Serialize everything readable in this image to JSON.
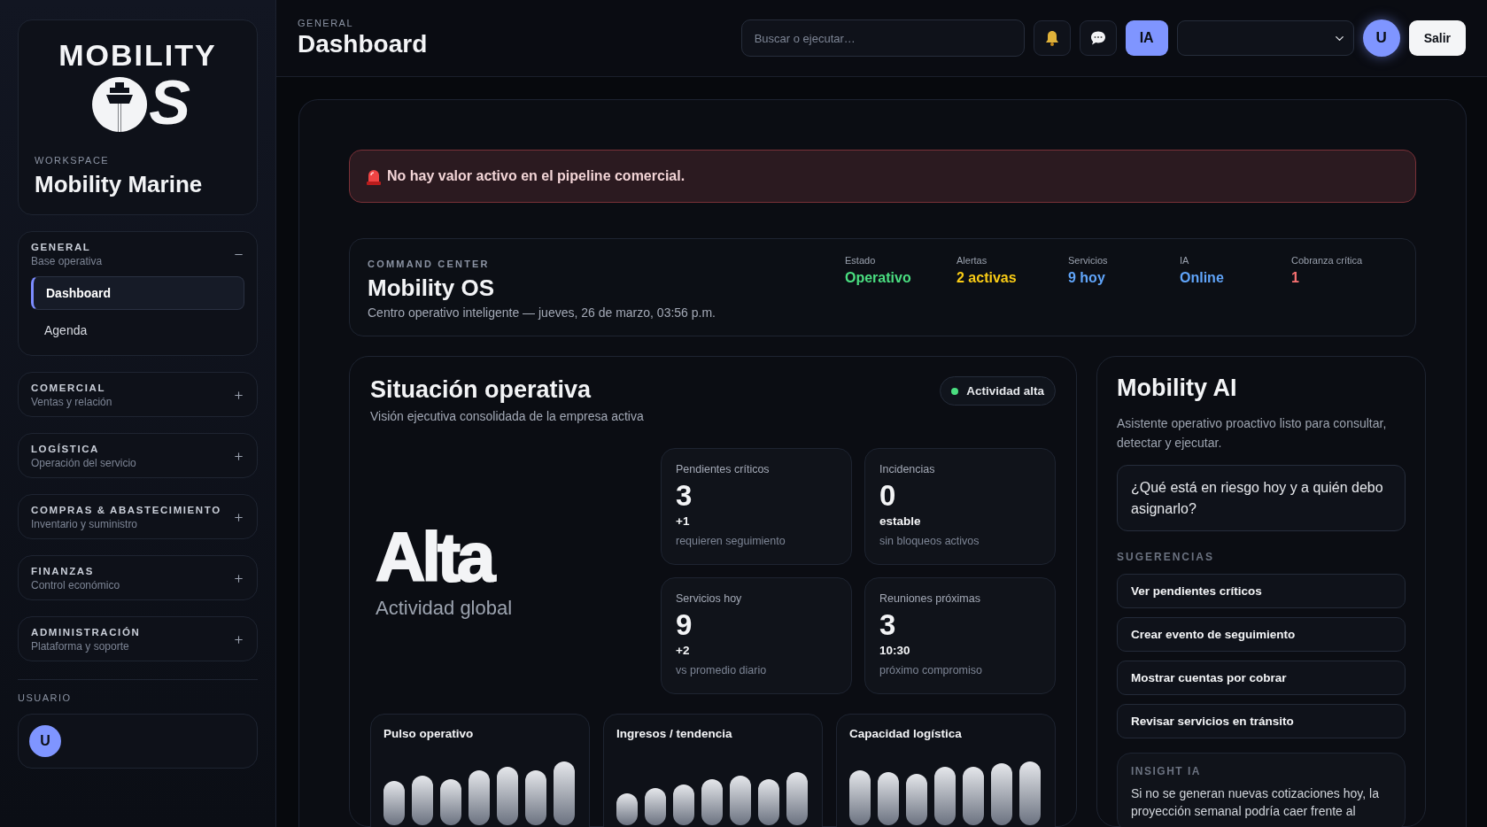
{
  "sidebar": {
    "logo": {
      "wordmark": "MOBILITY",
      "mark_letter": "S"
    },
    "workspace_label": "WORKSPACE",
    "workspace_name": "Mobility Marine",
    "groups": [
      {
        "title": "GENERAL",
        "subtitle": "Base operativa",
        "expanded": true,
        "items": [
          {
            "label": "Dashboard",
            "selected": true
          },
          {
            "label": "Agenda",
            "selected": false
          }
        ]
      },
      {
        "title": "COMERCIAL",
        "subtitle": "Ventas y relación",
        "expanded": false
      },
      {
        "title": "LOGÍSTICA",
        "subtitle": "Operación del servicio",
        "expanded": false
      },
      {
        "title": "COMPRAS & ABASTECIMIENTO",
        "subtitle": "Inventario y suministro",
        "expanded": false
      },
      {
        "title": "FINANZAS",
        "subtitle": "Control económico",
        "expanded": false
      },
      {
        "title": "ADMINISTRACIÓN",
        "subtitle": "Plataforma y soporte",
        "expanded": false
      }
    ],
    "user_label": "USUARIO",
    "user_initial": "U"
  },
  "header": {
    "section": "GENERAL",
    "title": "Dashboard",
    "search": {
      "placeholder": "Buscar o ejecutar…"
    },
    "ai_button": "IA",
    "avatar_initial": "U",
    "logout": "Salir"
  },
  "alert": {
    "text": "No hay valor activo en el pipeline comercial."
  },
  "command_center": {
    "eyebrow": "COMMAND CENTER",
    "title": "Mobility OS",
    "subtitle": "Centro operativo inteligente — jueves, 26 de marzo, 03:56 p.m.",
    "stats": [
      {
        "label": "Estado",
        "value": "Operativo",
        "color": "#4ade80"
      },
      {
        "label": "Alertas",
        "value": "2 activas",
        "color": "#facc15"
      },
      {
        "label": "Servicios",
        "value": "9 hoy",
        "color": "#60a5fa"
      },
      {
        "label": "IA",
        "value": "Online",
        "color": "#60a5fa"
      },
      {
        "label": "Cobranza crítica",
        "value": "1",
        "color": "#f87171"
      }
    ]
  },
  "situation": {
    "title": "Situación operativa",
    "subtitle": "Visión ejecutiva consolidada de la empresa activa",
    "status": {
      "label": "Actividad alta",
      "color": "#4ade80"
    },
    "hero": {
      "value": "Alta",
      "caption": "Actividad global"
    },
    "kpis": [
      {
        "label": "Pendientes críticos",
        "value": "3",
        "delta": "+1",
        "note": "requieren seguimiento"
      },
      {
        "label": "Incidencias",
        "value": "0",
        "delta": "estable",
        "note": "sin bloqueos activos"
      },
      {
        "label": "Servicios hoy",
        "value": "9",
        "delta": "+2",
        "note": "vs promedio diario"
      },
      {
        "label": "Reuniones próximas",
        "value": "3",
        "delta": "10:30",
        "note": "próximo compromiso"
      }
    ],
    "mini_charts": [
      {
        "title": "Pulso operativo"
      },
      {
        "title": "Ingresos / tendencia"
      },
      {
        "title": "Capacidad logística"
      }
    ]
  },
  "assistant": {
    "title": "Mobility AI",
    "description": "Asistente operativo proactivo listo para consultar, detectar y ejecutar.",
    "prompt": "¿Qué está en riesgo hoy y a quién debo asignarlo?",
    "suggestions_label": "SUGERENCIAS",
    "suggestions": [
      "Ver pendientes críticos",
      "Crear evento de seguimiento",
      "Mostrar cuentas por cobrar",
      "Revisar servicios en tránsito"
    ],
    "insight": {
      "label": "INSIGHT IA",
      "text": "Si no se generan nuevas cotizaciones hoy, la proyección semanal podría caer frente al"
    }
  }
}
